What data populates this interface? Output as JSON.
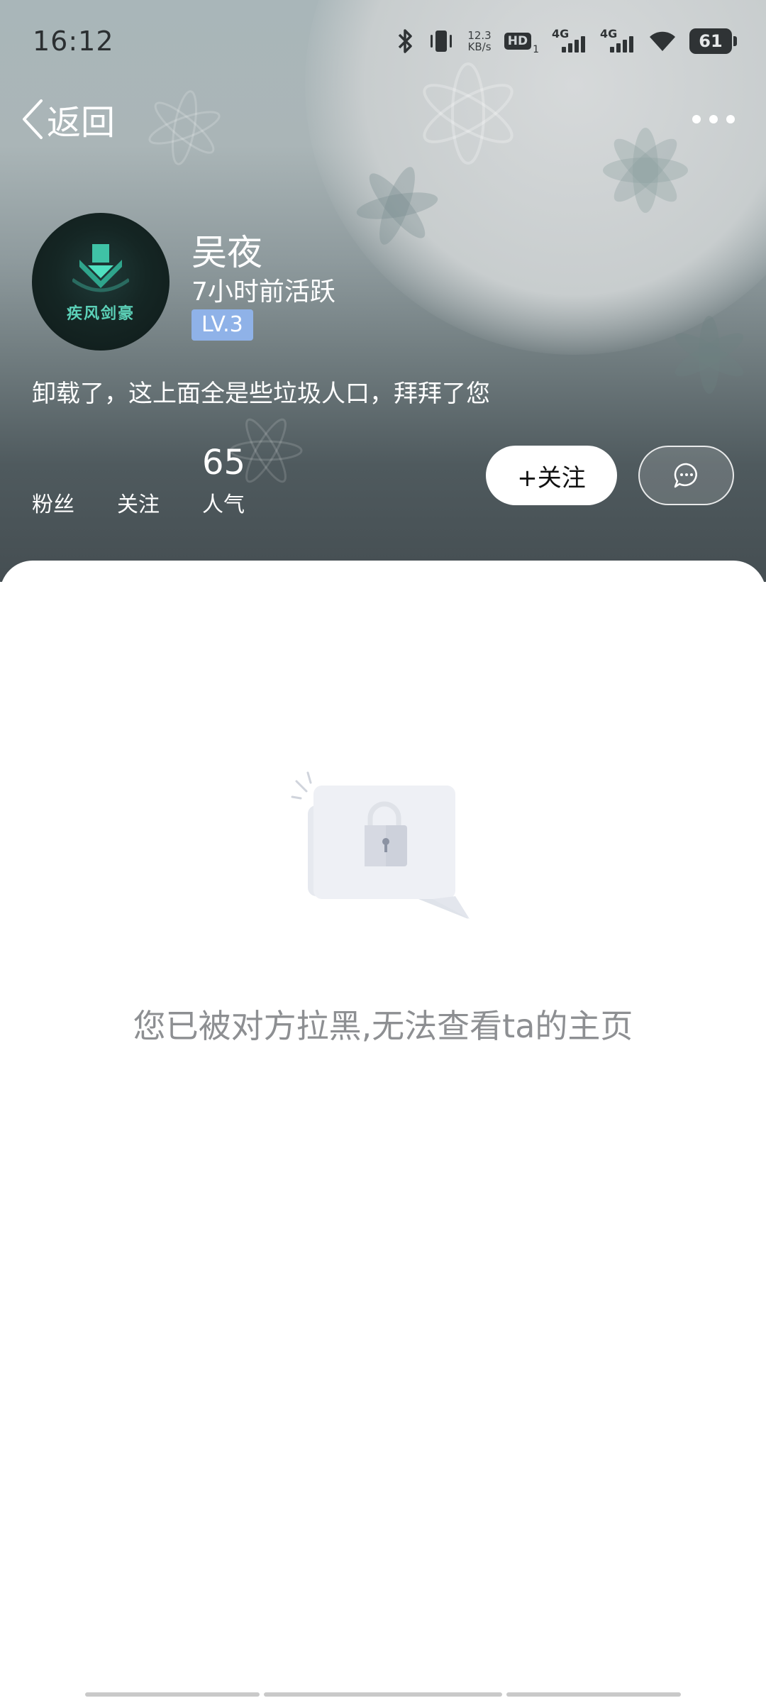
{
  "status_bar": {
    "time": "16:12",
    "net_speed_value": "12.3",
    "net_speed_unit": "KB/s",
    "hd_label": "HD",
    "hd_sub": "1",
    "signal1_label": "4G",
    "signal2_label": "4G",
    "battery": "61"
  },
  "nav": {
    "back_label": "返回"
  },
  "profile": {
    "avatar_text": "疾风剑豪",
    "name": "吴夜",
    "active_time": "7小时前活跃",
    "level": "LV.3",
    "bio": "卸载了，这上面全是些垃圾人口，拜拜了您"
  },
  "stats": [
    {
      "label": "粉丝",
      "value": ""
    },
    {
      "label": "关注",
      "value": ""
    },
    {
      "label": "人气",
      "value": "65"
    }
  ],
  "actions": {
    "follow_label": "+关注"
  },
  "content": {
    "blocked_message": "您已被对方拉黑,无法查看ta的主页"
  },
  "colors": {
    "level_badge": "#8fb2e8",
    "message_text": "#8d8f92",
    "avatar_accent": "#5cd1b8"
  }
}
